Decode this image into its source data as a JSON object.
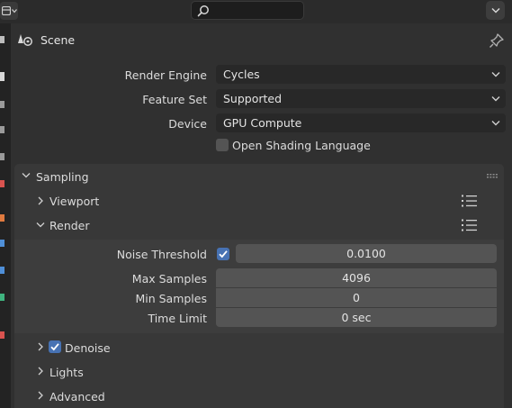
{
  "header": {
    "search": {
      "value": "",
      "placeholder": ""
    }
  },
  "context": {
    "title": "Scene"
  },
  "render": {
    "engine": {
      "label": "Render Engine",
      "value": "Cycles"
    },
    "feature_set": {
      "label": "Feature Set",
      "value": "Supported"
    },
    "device": {
      "label": "Device",
      "value": "GPU Compute"
    },
    "osl": {
      "label": "Open Shading Language",
      "checked": false
    }
  },
  "sampling": {
    "title": "Sampling",
    "viewport": {
      "title": "Viewport",
      "expanded": false
    },
    "render": {
      "title": "Render",
      "expanded": true,
      "noise_threshold": {
        "label": "Noise Threshold",
        "enabled": true,
        "value": "0.0100"
      },
      "max_samples": {
        "label": "Max Samples",
        "value": "4096"
      },
      "min_samples": {
        "label": "Min Samples",
        "value": "0"
      },
      "time_limit": {
        "label": "Time Limit",
        "value": "0 sec"
      }
    },
    "denoise": {
      "title": "Denoise",
      "checked": true,
      "expanded": false
    },
    "lights": {
      "title": "Lights",
      "expanded": false
    },
    "advanced": {
      "title": "Advanced",
      "expanded": false
    }
  },
  "colors": {
    "accent": "#4772b3",
    "panel_bg": "#383838",
    "editor_bg": "#303030",
    "field_bg": "#545454"
  }
}
